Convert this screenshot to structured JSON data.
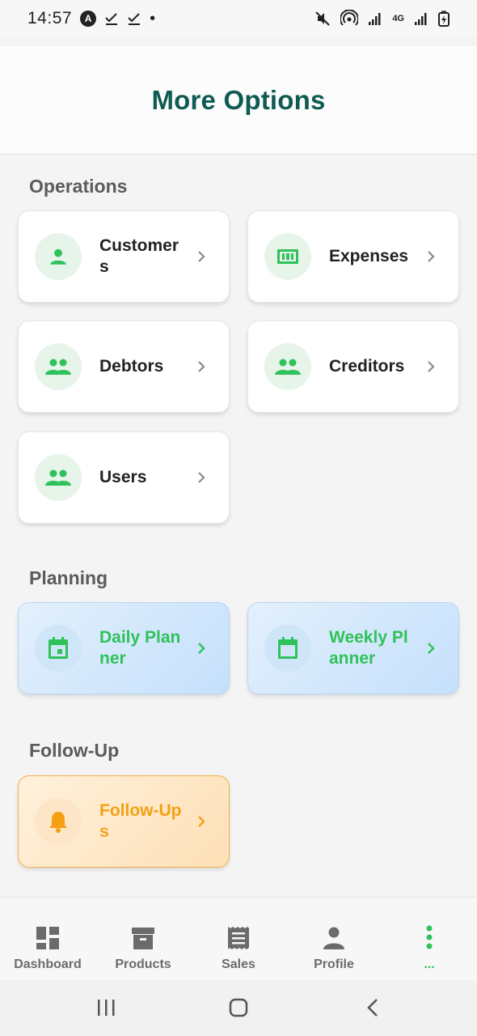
{
  "status_bar": {
    "time": "14:57",
    "badge": "A",
    "dot": "•",
    "network": "4G"
  },
  "header": {
    "title": "More Options"
  },
  "sections": {
    "operations": {
      "label": "Operations",
      "cards": [
        {
          "label": "Customers",
          "icon": "person-icon"
        },
        {
          "label": "Expenses",
          "icon": "money-icon"
        },
        {
          "label": "Debtors",
          "icon": "group-icon"
        },
        {
          "label": "Creditors",
          "icon": "group-icon"
        },
        {
          "label": "Users",
          "icon": "group-icon"
        }
      ]
    },
    "planning": {
      "label": "Planning",
      "cards": [
        {
          "label": "Daily Planner",
          "icon": "calendar-today-icon"
        },
        {
          "label": "Weekly Planner",
          "icon": "calendar-icon"
        }
      ]
    },
    "follow_up": {
      "label": "Follow-Up",
      "cards": [
        {
          "label": "Follow-Ups",
          "icon": "bell-icon"
        }
      ]
    }
  },
  "bottom_nav": {
    "items": [
      {
        "label": "Dashboard",
        "icon": "dashboard-icon"
      },
      {
        "label": "Products",
        "icon": "archive-box-icon"
      },
      {
        "label": "Sales",
        "icon": "receipt-icon"
      },
      {
        "label": "Profile",
        "icon": "person-icon"
      },
      {
        "label": "...",
        "icon": "more-vertical-icon"
      }
    ],
    "active_index": 4
  },
  "colors": {
    "title": "#0f5b53",
    "accent_green": "#2fc25a",
    "planner_bg": "#c5e0fb",
    "follow_bg": "#fde0b6",
    "follow_accent": "#f5a013",
    "icon_bg": "#e7f4ea"
  }
}
